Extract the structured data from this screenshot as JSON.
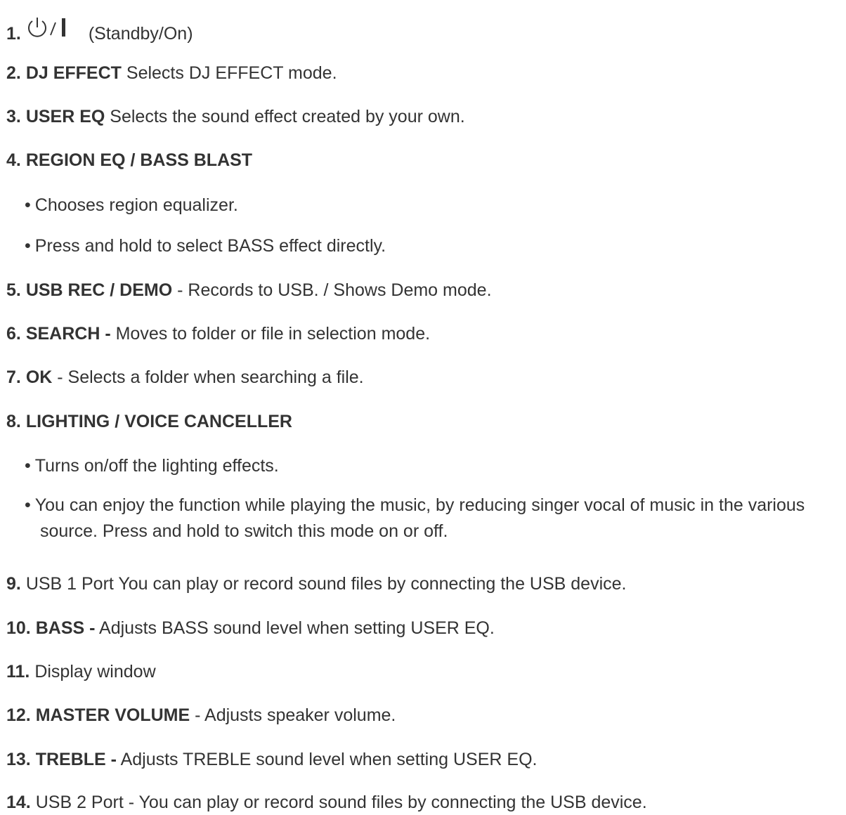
{
  "items": [
    {
      "num": "1.",
      "label": "",
      "desc": "(Standby/On)",
      "icon": "power-standby-on-icon"
    },
    {
      "num": "2.",
      "label": "DJ EFFECT",
      "desc": "Selects DJ EFFECT mode."
    },
    {
      "num": "3.",
      "label": "USER EQ",
      "desc": "Selects the sound effect created by your own."
    },
    {
      "num": "4.",
      "label": "REGION EQ / BASS BLAST",
      "desc": "",
      "bullets": [
        "Chooses region equalizer.",
        "Press and hold to select BASS effect directly."
      ]
    },
    {
      "num": "5.",
      "label": "USB REC / DEMO",
      "desc": "- Records to USB. / Shows Demo mode."
    },
    {
      "num": "6.",
      "label": "SEARCH -",
      "desc": "Moves to folder or file in selection mode."
    },
    {
      "num": "7.",
      "label": "OK",
      "desc": "- Selects a folder when searching a file."
    },
    {
      "num": "8.",
      "label": "LIGHTING / VOICE CANCELLER",
      "desc": "",
      "bullets": [
        "Turns on/off the lighting effects.",
        "You can enjoy the function while playing the music, by reducing singer vocal of music in the various source. Press and hold to switch this mode on or off."
      ]
    },
    {
      "num": "9.",
      "label": "",
      "desc": "USB 1 Port You can play or record sound files by connecting the USB device."
    },
    {
      "num": "10.",
      "label": "BASS -",
      "desc": "Adjusts BASS sound level when setting USER EQ."
    },
    {
      "num": "11.",
      "label": "",
      "desc": "Display window"
    },
    {
      "num": "12.",
      "label": "MASTER VOLUME",
      "desc": "- Adjusts speaker volume."
    },
    {
      "num": "13.",
      "label": "TREBLE -",
      "desc": "Adjusts TREBLE sound level when setting USER EQ."
    },
    {
      "num": "14.",
      "label": "",
      "desc": "USB 2 Port - You can play or record sound files by connecting the USB device."
    }
  ],
  "bullet_char": "•"
}
